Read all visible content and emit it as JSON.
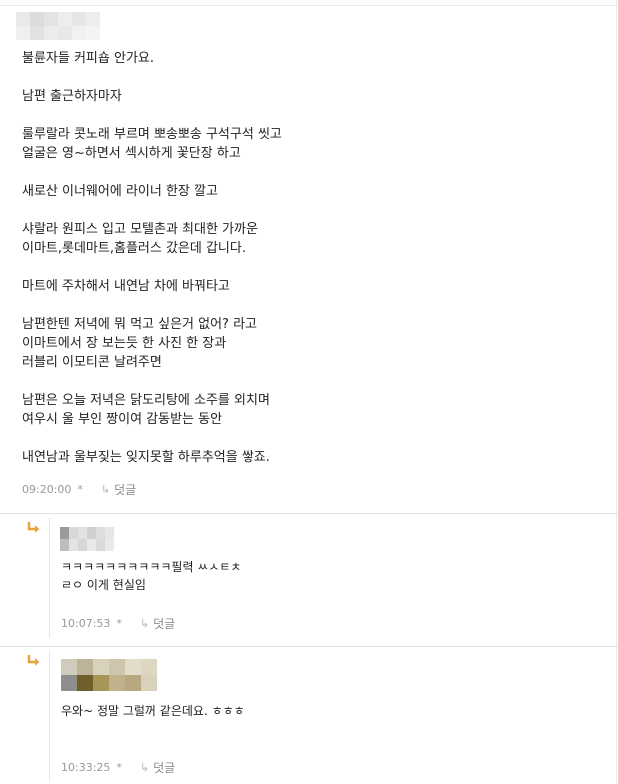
{
  "post": {
    "paragraphs": [
      "불륜자들 커피숍 안가요.",
      "남편 출근하자마자",
      "룰루랄라 콧노래 부르며 뽀송뽀송 구석구석 씻고\n얼굴은 영~하면서 섹시하게 꽃단장 하고",
      "새로산 이너웨어에 라이너 한장 깔고",
      "샤랄라 원피스 입고 모텔촌과 최대한 가까운\n이마트,롯데마트,홈플러스 갔은데 갑니다.",
      "마트에 주차해서 내연남 차에 바꿔타고",
      "남편한텐 저녁에 뭐 먹고 싶은거 없어? 라고\n이마트에서 장 보는듯 한 사진 한 장과\n러블리 이모티콘 날려주면",
      "남편은 오늘 저녁은 닭도리탕에 소주를 외치며\n여우시 울 부인 짱이여 감동받는 동안",
      "내연남과 울부짖는 잊지못할 하루추억을 쌓죠."
    ],
    "time": "09:20:00",
    "star": "*",
    "reply_label": "덧글"
  },
  "replies": [
    {
      "text": "ㅋㅋㅋㅋㅋㅋㅋㅋㅋㅋ필력 ㅆㅅㅌㅊ\nㄹㅇ 이게 현실임",
      "time": "10:07:53",
      "star": "*",
      "reply_label": "덧글"
    },
    {
      "text": "우와~  정말 그럴꺼 같은데요.  ㅎㅎㅎ",
      "time": "10:33:25",
      "star": "*",
      "reply_label": "덧글"
    }
  ],
  "colors": {
    "reply_arrow": "#e8a23a",
    "meta_text": "#999999",
    "separator": "#e4e4e4"
  },
  "icons": {
    "reply_indicator": "reply-arrow-icon",
    "reply_link": "reply-link-arrow-icon"
  }
}
